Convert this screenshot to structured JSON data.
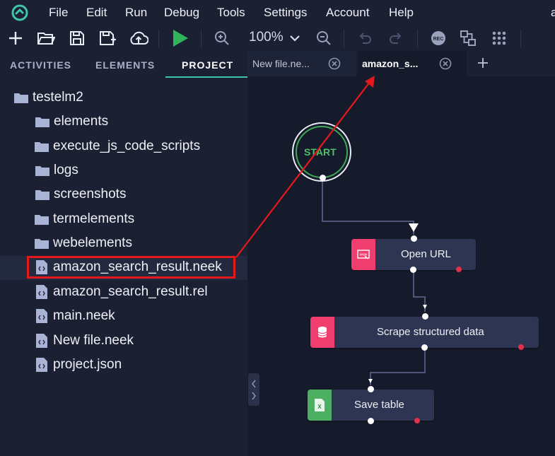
{
  "menu": {
    "items": [
      "File",
      "Edit",
      "Run",
      "Debug",
      "Tools",
      "Settings",
      "Account",
      "Help"
    ],
    "overflow_text": "a"
  },
  "toolbar": {
    "zoom": "100%",
    "icons": [
      "plus-icon",
      "open-folder-icon",
      "save-icon",
      "save-as-icon",
      "cloud-upload-icon",
      "run-icon",
      "zoom-in-icon",
      "zoom-out-icon",
      "undo-icon",
      "redo-icon",
      "record-icon",
      "layout-icon",
      "grid-icon"
    ]
  },
  "sidebar": {
    "tabs": [
      "ACTIVITIES",
      "ELEMENTS",
      "PROJECT"
    ],
    "active_tab": "PROJECT",
    "tree": {
      "root": "testelm2",
      "items": [
        {
          "label": "elements",
          "type": "folder",
          "expandable": true
        },
        {
          "label": "execute_js_code_scripts",
          "type": "folder",
          "expandable": false
        },
        {
          "label": "logs",
          "type": "folder",
          "expandable": true
        },
        {
          "label": "screenshots",
          "type": "folder",
          "expandable": true
        },
        {
          "label": "termelements",
          "type": "folder",
          "expandable": false
        },
        {
          "label": "webelements",
          "type": "folder",
          "expandable": false
        },
        {
          "label": "amazon_search_result.neek",
          "type": "file",
          "selected": true
        },
        {
          "label": "amazon_search_result.rel",
          "type": "file"
        },
        {
          "label": "main.neek",
          "type": "file"
        },
        {
          "label": "New file.neek",
          "type": "file"
        },
        {
          "label": "project.json",
          "type": "file"
        }
      ]
    }
  },
  "editor_tabs": [
    {
      "label": "New file.ne...",
      "active": false
    },
    {
      "label": "amazon_s...",
      "active": true
    }
  ],
  "flow": {
    "start_label": "START",
    "nodes": [
      {
        "label": "Open URL",
        "icon": "web-icon",
        "color": "#f03e6e"
      },
      {
        "label": "Scrape structured data",
        "icon": "database-icon",
        "color": "#f03e6e"
      },
      {
        "label": "Save table",
        "icon": "excel-icon",
        "color": "#4caf62"
      }
    ]
  },
  "colors": {
    "accent": "#3ec6a8",
    "run_green": "#2fb45a",
    "highlight_red": "#e5191b",
    "node_bg": "#2e3552"
  }
}
